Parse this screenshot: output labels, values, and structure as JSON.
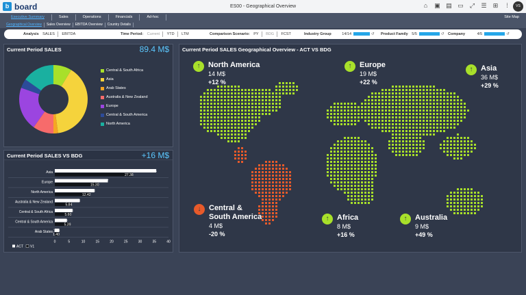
{
  "window": {
    "title": "ES00 - Geographical Overview",
    "logo_text": "board",
    "logo_letter": "b",
    "user_initials": "VS"
  },
  "nav": {
    "tabs": [
      "Executive Summary",
      "Sales",
      "Operations",
      "Financials",
      "Ad-hoc"
    ],
    "active_tab": 0,
    "subtabs": [
      "Geographical Overview",
      "Sales Overview",
      "EBITDA Overview",
      "Country Details"
    ],
    "active_subtab": 0,
    "site_map": "Site Map"
  },
  "filters": {
    "analysis_label": "Analysis",
    "analysis_opts": [
      "SALES",
      "EBITDA"
    ],
    "time_label": "Time Period:",
    "time_opts": [
      "Current",
      "YTD",
      "LTM"
    ],
    "comparison_label": "Comparison Scenario:",
    "comparison_opts": [
      "PY",
      "BDG",
      "FCST"
    ],
    "industry_label": "Industry Group",
    "industry_count": "14/14",
    "product_label": "Product Family",
    "product_count": "5/5",
    "company_label": "Company",
    "company_count": "4/5",
    "colors": {
      "bar": "#25a6e8"
    }
  },
  "sales_panel": {
    "title": "Current Period SALES",
    "total": "89.4 M$",
    "legend": [
      {
        "label": "Central & South Africa",
        "color": "#a8e02a"
      },
      {
        "label": "Asia",
        "color": "#f5d33c"
      },
      {
        "label": "Arab States",
        "color": "#f5a623"
      },
      {
        "label": "Australia & New Zealand",
        "color": "#f76b6b"
      },
      {
        "label": "Europe",
        "color": "#9b45e0"
      },
      {
        "label": "Central & South America",
        "color": "#2c4b9a"
      },
      {
        "label": "North America",
        "color": "#1ab0a0"
      }
    ]
  },
  "bdg_panel": {
    "title": "Current Period SALES VS BDG",
    "delta": "+16 M$",
    "legend_act": "ACT",
    "legend_v1": "V1"
  },
  "chart_data": [
    {
      "type": "pie",
      "title": "Current Period SALES",
      "categories": [
        "Central & South Africa",
        "Asia",
        "Arab States",
        "Australia & New Zealand",
        "Europe",
        "Central & South America",
        "North America"
      ],
      "values": [
        8,
        36,
        2,
        9,
        19,
        4,
        14
      ]
    },
    {
      "type": "bar",
      "title": "Current Period SALES VS BDG",
      "categories": [
        "Asia",
        "Europe",
        "North America",
        "Australia & New Zealand",
        "Central & South Africa",
        "Central & South America",
        "Arab States"
      ],
      "series": [
        {
          "name": "ACT",
          "values": [
            35.65,
            18.67,
            13.93,
            8.73,
            6.18,
            4.2,
            1.56
          ]
        },
        {
          "name": "V1",
          "values": [
            27.38,
            15.3,
            12.42,
            5.84,
            5.6,
            5.39,
            1.4
          ]
        }
      ],
      "xlim": [
        0,
        40
      ],
      "xticks": [
        0,
        5,
        10,
        15,
        20,
        25,
        30,
        35,
        40
      ],
      "value_labels": [
        [
          "35.65",
          "27.38"
        ],
        [
          "18.67",
          "15.30"
        ],
        [
          "13.93",
          "12.42"
        ],
        [
          "8.73",
          "5.84"
        ],
        [
          "6.18",
          "5.60"
        ],
        [
          "4.20",
          "5.39"
        ],
        [
          "1.56",
          "1.40"
        ]
      ]
    }
  ],
  "map_panel": {
    "title": "Current Period SALES Geographical Overview - ACT  VS BDG",
    "colors": {
      "up": "#a8e02a",
      "down": "#e85a2a"
    },
    "regions": [
      {
        "name": "North America",
        "value": "14 M$",
        "pct": "+12 %",
        "trend": "up"
      },
      {
        "name": "Europe",
        "value": "19 M$",
        "pct": "+22 %",
        "trend": "up"
      },
      {
        "name": "Asia",
        "value": "36 M$",
        "pct": "+29 %",
        "trend": "up"
      },
      {
        "name": "Central &",
        "name2": "South America",
        "value": "4 M$",
        "pct": "-20 %",
        "trend": "down"
      },
      {
        "name": "Africa",
        "value": "8 M$",
        "pct": "+16 %",
        "trend": "up"
      },
      {
        "name": "Australia",
        "value": "9 M$",
        "pct": "+49 %",
        "trend": "up"
      }
    ]
  }
}
